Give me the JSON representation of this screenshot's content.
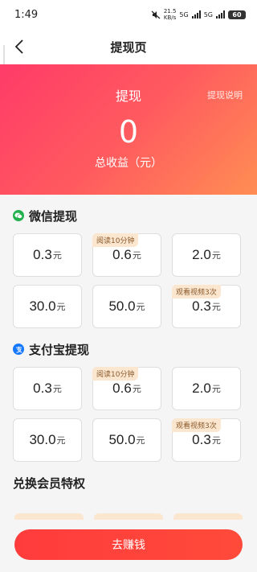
{
  "status_bar": {
    "time": "1:49",
    "speed": "21.5",
    "speed_unit": "KB/s",
    "net1": "5G",
    "net2": "5G",
    "battery": "60"
  },
  "nav": {
    "back_icon": "chevron-left-icon",
    "title": "提现页"
  },
  "hero": {
    "title": "提现",
    "help_link": "提现说明",
    "amount": "0",
    "amount_label": "总收益（元）"
  },
  "wechat": {
    "icon": "wechat-icon",
    "title": "微信提现",
    "options": [
      {
        "amount": "0.3",
        "unit": "元",
        "tag": ""
      },
      {
        "amount": "0.6",
        "unit": "元",
        "tag": "阅读10分钟"
      },
      {
        "amount": "2.0",
        "unit": "元",
        "tag": ""
      },
      {
        "amount": "30.0",
        "unit": "元",
        "tag": ""
      },
      {
        "amount": "50.0",
        "unit": "元",
        "tag": ""
      },
      {
        "amount": "0.3",
        "unit": "元",
        "tag": "观看视频3次"
      }
    ]
  },
  "alipay": {
    "icon": "alipay-icon",
    "title": "支付宝提现",
    "options": [
      {
        "amount": "0.3",
        "unit": "元",
        "tag": ""
      },
      {
        "amount": "0.6",
        "unit": "元",
        "tag": "阅读10分钟"
      },
      {
        "amount": "2.0",
        "unit": "元",
        "tag": ""
      },
      {
        "amount": "30.0",
        "unit": "元",
        "tag": ""
      },
      {
        "amount": "50.0",
        "unit": "元",
        "tag": ""
      },
      {
        "amount": "0.3",
        "unit": "元",
        "tag": "观看视频3次"
      }
    ]
  },
  "membership": {
    "title": "兑换会员特权"
  },
  "cta": {
    "label": "去赚钱"
  },
  "colors": {
    "accent_red": "#ff3c3c",
    "gradient_start": "#ff3b68",
    "gradient_end": "#ff8e53",
    "tag_bg": "#fbe6cf",
    "wechat_green": "#22b14c",
    "alipay_blue": "#1677ff"
  }
}
